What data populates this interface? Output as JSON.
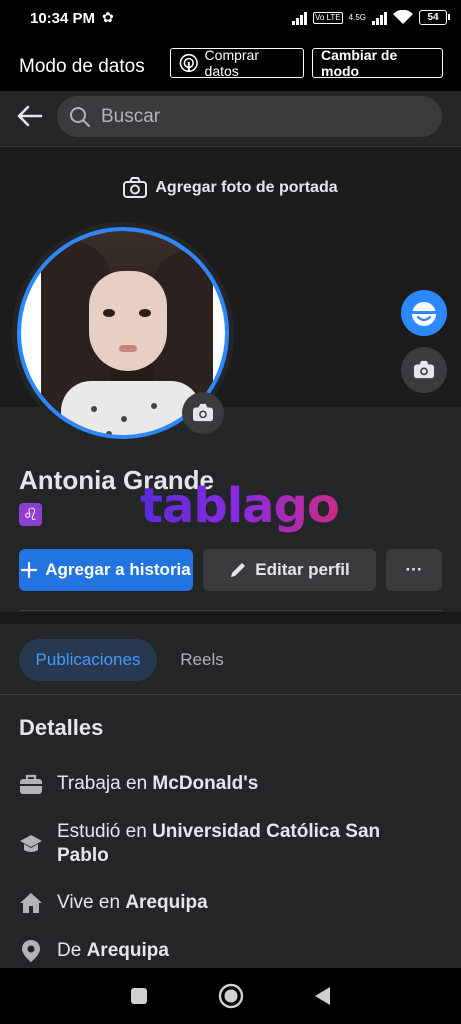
{
  "status_bar": {
    "time": "10:34 PM",
    "network": "4.5G",
    "battery": "54",
    "volte": "Vo LTE"
  },
  "data_mode_bar": {
    "title": "Modo de datos",
    "buy_label": "Comprar datos",
    "change_mode_label": "Cambiar de modo"
  },
  "search": {
    "placeholder": "Buscar"
  },
  "cover": {
    "add_cover_label": "Agregar foto de portada"
  },
  "profile": {
    "name": "Antonia Grande",
    "zodiac_symbol": "♌",
    "watermark": "tablago"
  },
  "actions": {
    "story_label": "Agregar a historia",
    "edit_label": "Editar perfil",
    "more_label": "···"
  },
  "tabs": [
    {
      "label": "Publicaciones",
      "active": true
    },
    {
      "label": "Reels",
      "active": false
    }
  ],
  "details": {
    "title": "Detalles",
    "rows": [
      {
        "icon": "briefcase-icon",
        "prefix": "Trabaja en ",
        "value": "McDonald's"
      },
      {
        "icon": "graduation-cap-icon",
        "prefix": "Estudió en ",
        "value": "Universidad Católica San Pablo"
      },
      {
        "icon": "home-icon",
        "prefix": "Vive en ",
        "value": "Arequipa"
      },
      {
        "icon": "location-pin-icon",
        "prefix": "De ",
        "value": "Arequipa"
      }
    ]
  },
  "colors": {
    "accent": "#2374e1",
    "ring": "#2d88ff",
    "background": "#242526"
  }
}
